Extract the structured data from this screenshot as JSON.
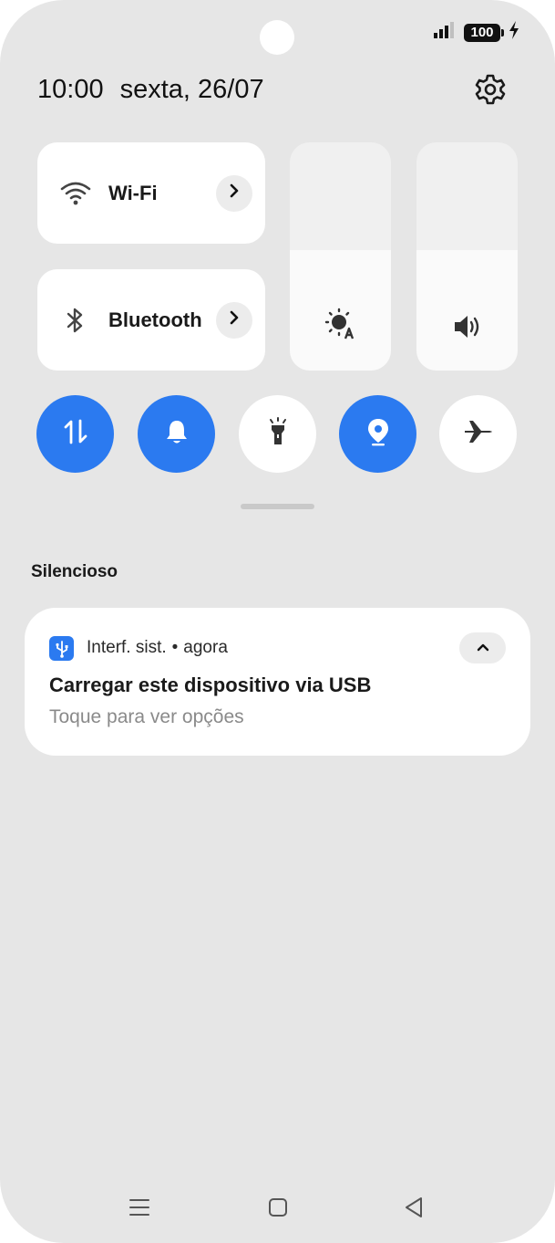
{
  "status_bar": {
    "battery": "100",
    "icons": [
      "signal-icon",
      "battery-icon",
      "charging-bolt-icon"
    ]
  },
  "header": {
    "time": "10:00",
    "date": "sexta, 26/07",
    "settings_icon": "gear-icon"
  },
  "quick_tiles": [
    {
      "label": "Wi-Fi",
      "icon": "wifi-icon"
    },
    {
      "label": "Bluetooth",
      "icon": "bluetooth-icon"
    }
  ],
  "sliders": {
    "brightness": {
      "icon": "auto-brightness-icon",
      "level": 0.53
    },
    "volume": {
      "icon": "volume-icon",
      "level": 0.53
    }
  },
  "toggles": [
    {
      "name": "mobile-data",
      "icon": "data-arrows-icon",
      "on": true
    },
    {
      "name": "sound",
      "icon": "bell-icon",
      "on": true
    },
    {
      "name": "flashlight",
      "icon": "flashlight-icon",
      "on": false
    },
    {
      "name": "location",
      "icon": "location-pin-icon",
      "on": true
    },
    {
      "name": "airplane-mode",
      "icon": "airplane-icon",
      "on": false
    }
  ],
  "notifications_section": {
    "label": "Silencioso"
  },
  "notification": {
    "app": "Interf. sist.",
    "separator": "•",
    "time": "agora",
    "title": "Carregar este dispositivo via USB",
    "body": "Toque para ver opções",
    "icon": "usb-icon"
  },
  "navbar": [
    "menu-icon",
    "home-icon",
    "back-icon"
  ],
  "colors": {
    "accent": "#2b7af0",
    "panel_bg": "#e6e6e6",
    "tile_bg": "#ffffff"
  }
}
